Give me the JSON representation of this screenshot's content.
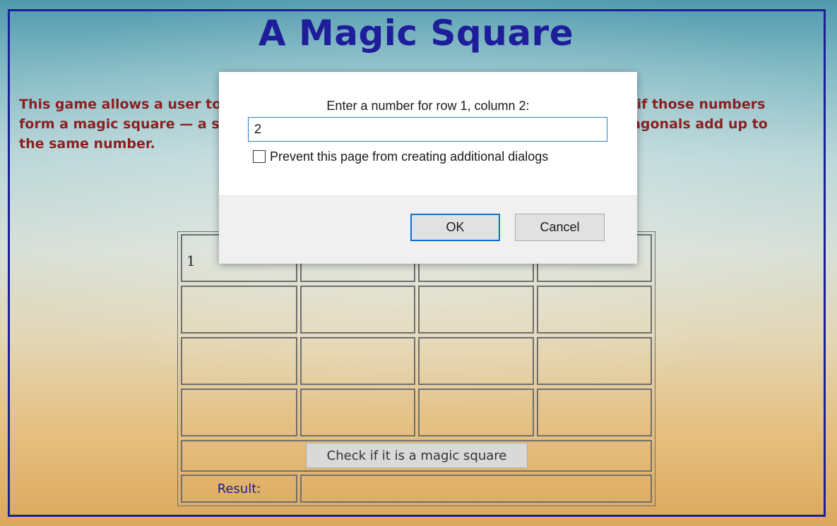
{
  "page": {
    "title": "A Magic Square",
    "description": "This game allows a user to enter 16 numbers into a 4 × 4 grid, then check to see if those numbers form a magic square — a square where the sums of all the rows, columns, and diagonals add up to the same number."
  },
  "grid": {
    "cells": [
      [
        "1",
        "",
        "",
        ""
      ],
      [
        "",
        "",
        "",
        ""
      ],
      [
        "",
        "",
        "",
        ""
      ],
      [
        "",
        "",
        "",
        ""
      ]
    ],
    "check_button_label": "Check if it is a magic square",
    "result_label": "Result:",
    "result_value": ""
  },
  "dialog": {
    "message": "Enter a number for row 1, column 2:",
    "input_value": "2",
    "checkbox_label": "Prevent this page from creating additional dialogs",
    "checkbox_checked": false,
    "ok_label": "OK",
    "cancel_label": "Cancel"
  },
  "colors": {
    "frame": "#1c2096",
    "title": "#1e1e9a",
    "description": "#8c1f1f",
    "focus": "#0a6fd6"
  }
}
